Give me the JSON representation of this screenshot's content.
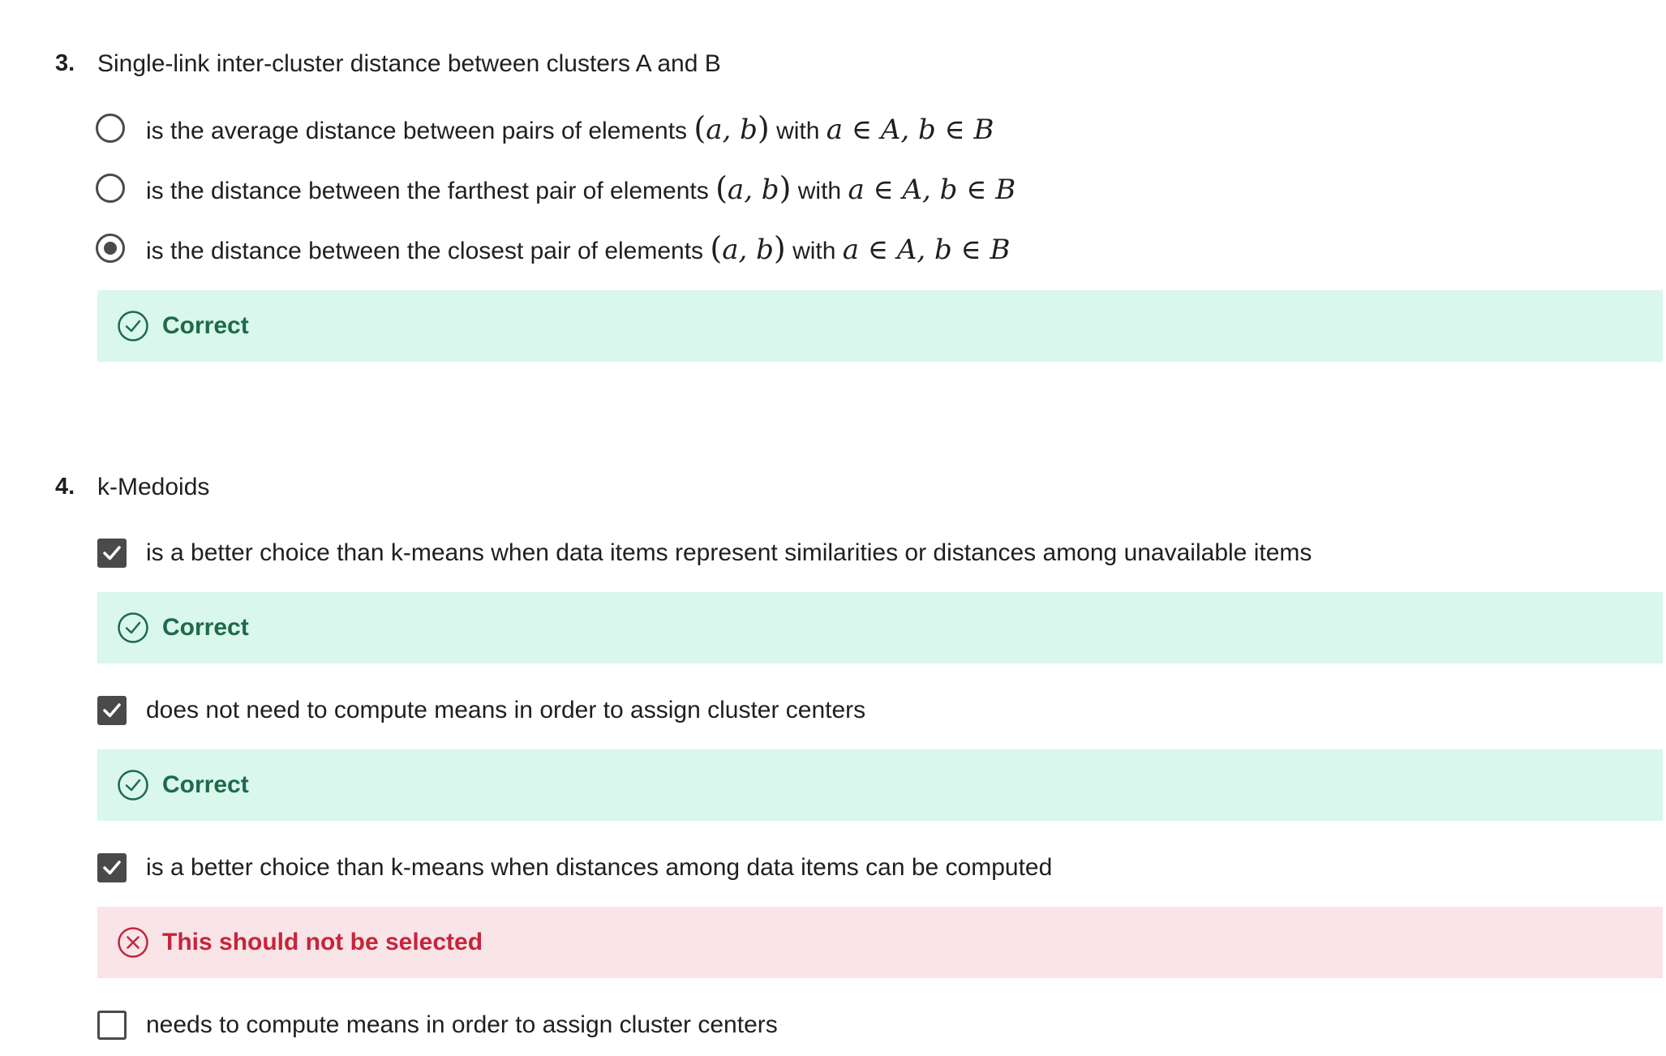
{
  "question3": {
    "number": "3.",
    "prompt": "Single-link inter-cluster distance between clusters A and B",
    "options": [
      {
        "text": "is the average distance between pairs of elements",
        "selected": false
      },
      {
        "text": "is the distance between the farthest pair of elements",
        "selected": false
      },
      {
        "text": "is the distance between the closest pair of elements",
        "selected": true
      }
    ],
    "math": {
      "pair_open": "(",
      "pair": "a, b",
      "pair_close": ")",
      "with": "with",
      "membership": "a ∈ A, b ∈ B"
    },
    "feedback": {
      "status": "Correct",
      "icon": "check-circle-icon",
      "color": "#1e6a4a",
      "bg": "#d9f7ed"
    }
  },
  "question4": {
    "number": "4.",
    "prompt": "k-Medoids",
    "options": [
      {
        "text": "is a better choice than k-means when data items represent similarities or distances among unavailable items",
        "checked": true,
        "feedback": {
          "status": "Correct",
          "icon": "check-circle-icon"
        }
      },
      {
        "text": "does not need to compute means in order to assign cluster centers",
        "checked": true,
        "feedback": {
          "status": "Correct",
          "icon": "check-circle-icon"
        }
      },
      {
        "text": "is a better choice than k-means when distances among data items can be computed",
        "checked": true,
        "feedback": {
          "status": "This should not be selected",
          "icon": "x-circle-icon"
        }
      },
      {
        "text": "needs to compute means in order to assign cluster centers",
        "checked": false
      }
    ]
  },
  "colors": {
    "correct_bg": "#d9f7ed",
    "correct_text": "#1e6a4a",
    "incorrect_bg": "#f9e4e8",
    "incorrect_text": "#c4263a",
    "control": "#4a4a4a"
  }
}
